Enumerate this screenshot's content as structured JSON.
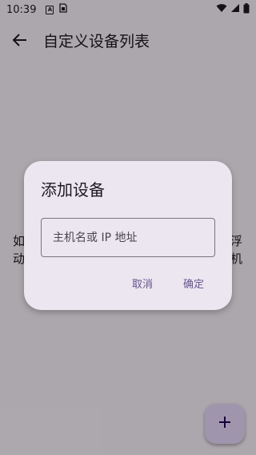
{
  "status_bar": {
    "time": "10:39",
    "icon_a": "A"
  },
  "app_bar": {
    "title": "自定义设备列表"
  },
  "background": {
    "left_text": "如\n动",
    "right_text": "浮\n机"
  },
  "dialog": {
    "title": "添加设备",
    "host_field_placeholder": "主机名或 IP 地址",
    "cancel_label": "取消",
    "ok_label": "确定"
  },
  "colors": {
    "accent": "#65558f",
    "dialog_bg": "#ece6f0",
    "fab_bg": "#eaddff"
  },
  "icons": {
    "back": "arrow-back-icon",
    "fab": "add-icon"
  }
}
